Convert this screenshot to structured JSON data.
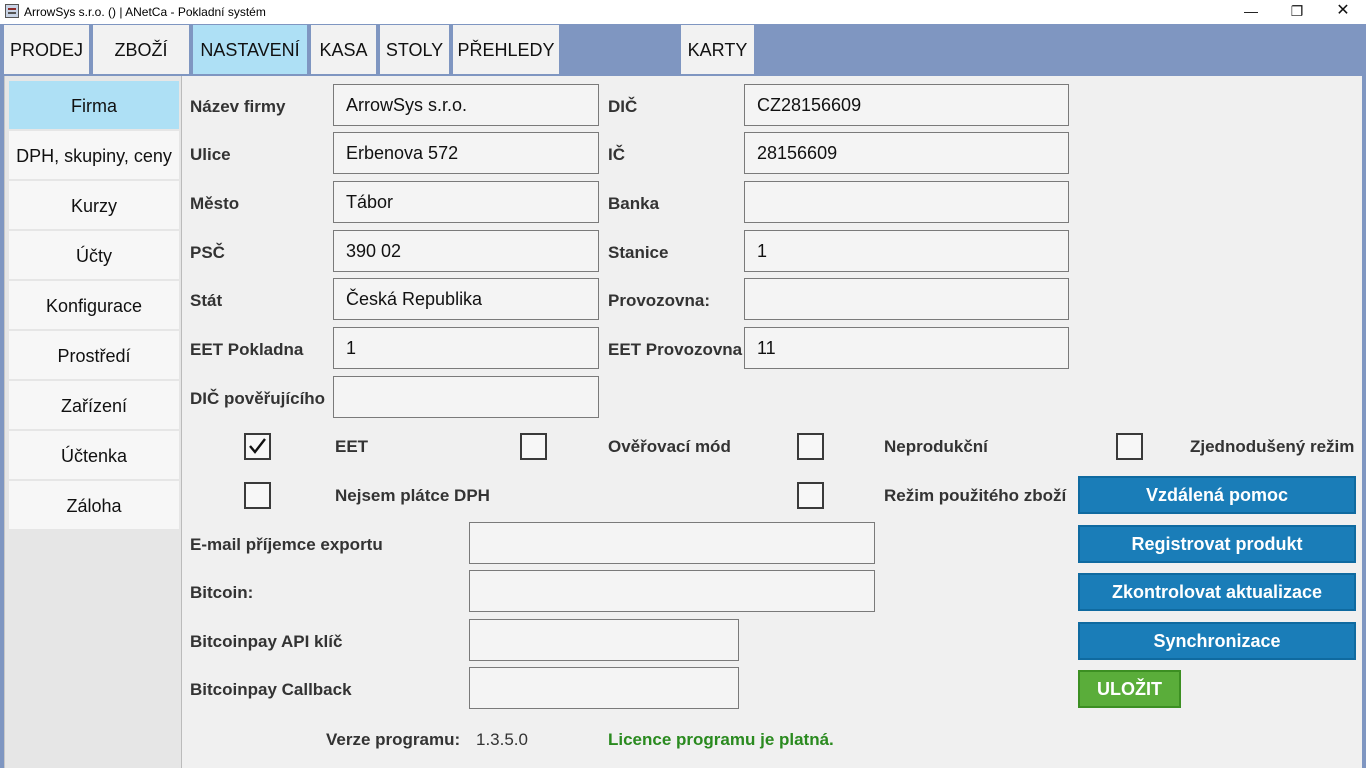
{
  "window": {
    "title": "ArrowSys s.r.o. () | ANetCa - Pokladní systém",
    "minimize_glyph": "—",
    "maximize_glyph": "❐",
    "close_glyph": "✕"
  },
  "tabs": [
    {
      "label": "PRODEJ",
      "active": false
    },
    {
      "label": "ZBOŽÍ",
      "active": false
    },
    {
      "label": "NASTAVENÍ",
      "active": true
    },
    {
      "label": "KASA",
      "active": false
    },
    {
      "label": "STOLY",
      "active": false
    },
    {
      "label": "PŘEHLEDY",
      "active": false
    },
    {
      "label": "KARTY",
      "active": false
    }
  ],
  "sidebar": {
    "items": [
      {
        "label": "Firma",
        "active": true
      },
      {
        "label": "DPH, skupiny, ceny",
        "active": false
      },
      {
        "label": "Kurzy",
        "active": false
      },
      {
        "label": "Účty",
        "active": false
      },
      {
        "label": "Konfigurace",
        "active": false
      },
      {
        "label": "Prostředí",
        "active": false
      },
      {
        "label": "Zařízení",
        "active": false
      },
      {
        "label": "Účtenka",
        "active": false
      },
      {
        "label": "Záloha",
        "active": false
      }
    ]
  },
  "form": {
    "nazev_firmy": {
      "label": "Název firmy",
      "value": "ArrowSys s.r.o."
    },
    "ulice": {
      "label": "Ulice",
      "value": "Erbenova 572"
    },
    "mesto": {
      "label": "Město",
      "value": "Tábor"
    },
    "psc": {
      "label": "PSČ",
      "value": "390 02"
    },
    "stat": {
      "label": "Stát",
      "value": "Česká Republika"
    },
    "eet_pokladna": {
      "label": "EET Pokladna",
      "value": "1"
    },
    "dic_poverujiciho": {
      "label": "DIČ pověřujícího",
      "value": ""
    },
    "dic": {
      "label": "DIČ",
      "value": "CZ28156609"
    },
    "ic": {
      "label": "IČ",
      "value": "28156609"
    },
    "banka": {
      "label": "Banka",
      "value": ""
    },
    "stanice": {
      "label": "Stanice",
      "value": "1"
    },
    "provozovna": {
      "label": "Provozovna:",
      "value": ""
    },
    "eet_provozovna": {
      "label": "EET Provozovna",
      "value": "11"
    },
    "email": {
      "label": "E-mail příjemce exportu",
      "value": ""
    },
    "bitcoin": {
      "label": "Bitcoin:",
      "value": ""
    },
    "bitcoinpay_api": {
      "label": "Bitcoinpay API klíč",
      "value": ""
    },
    "bitcoinpay_callback": {
      "label": "Bitcoinpay Callback",
      "value": ""
    }
  },
  "checkboxes": {
    "eet": {
      "label": "EET",
      "checked": true
    },
    "overovaci_mod": {
      "label": "Ověřovací mód",
      "checked": false
    },
    "neprodukcni": {
      "label": "Neprodukční",
      "checked": false
    },
    "zjednoduseny": {
      "label": "Zjednodušený režim",
      "checked": false
    },
    "nejsem_platce": {
      "label": "Nejsem plátce DPH",
      "checked": false
    },
    "pouzite_zbozi": {
      "label": "Režim použitého zboží",
      "checked": false
    }
  },
  "actions": {
    "vzdalena_pomoc": "Vzdálená pomoc",
    "registrovat": "Registrovat produkt",
    "aktualizace": "Zkontrolovat aktualizace",
    "synchronizace": "Synchronizace",
    "ulozit": "ULOŽIT"
  },
  "status": {
    "version_label": "Verze programu:",
    "version_value": "1.3.5.0",
    "licence_text": "Licence programu je platná."
  },
  "colors": {
    "tab_bar": "#7f96c1",
    "active_tab": "#aee0f5",
    "action_button": "#1a7db8",
    "save_button": "#5aad3a",
    "licence_text": "#2a8a1f"
  }
}
